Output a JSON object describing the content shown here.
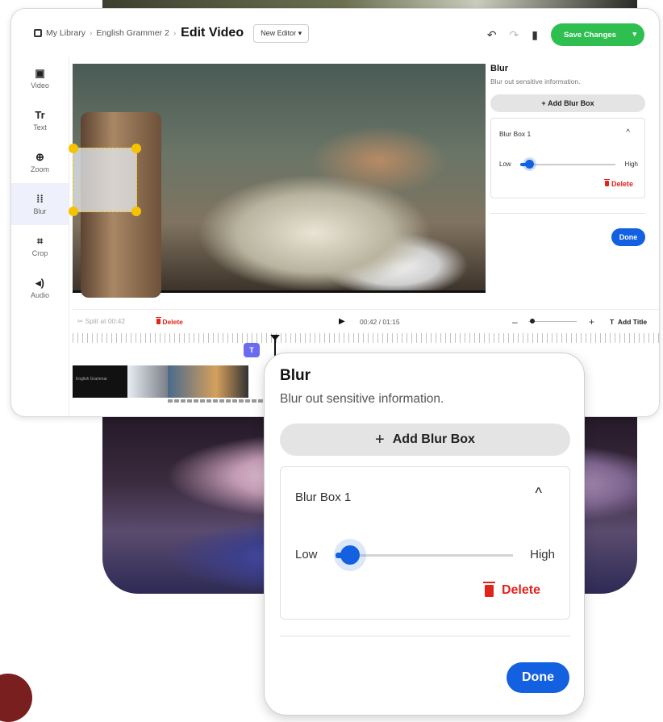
{
  "colors": {
    "accent": "#1360e0",
    "save": "#2fbf50",
    "danger": "#e2231a",
    "blur_handle": "#f5c300",
    "title_badge": "#6b6bf0"
  },
  "header": {
    "breadcrumb": [
      "My Library",
      "English Grammer 2"
    ],
    "title": "Edit Video",
    "editor_select": "New Editor",
    "save_label": "Save Changes"
  },
  "sidebar": {
    "items": [
      {
        "label": "Video",
        "icon": "video-icon"
      },
      {
        "label": "Text",
        "icon": "text-icon"
      },
      {
        "label": "Zoom",
        "icon": "zoom-icon"
      },
      {
        "label": "Blur",
        "icon": "blur-icon",
        "active": true
      },
      {
        "label": "Crop",
        "icon": "crop-icon"
      },
      {
        "label": "Audio",
        "icon": "audio-icon"
      }
    ]
  },
  "panel": {
    "title": "Blur",
    "subtitle": "Blur out sensitive information.",
    "add_label": "Add Blur Box",
    "box_name": "Blur Box 1",
    "low_label": "Low",
    "high_label": "High",
    "blur_level": 0.08,
    "delete_label": "Delete",
    "done_label": "Done"
  },
  "timeline": {
    "split_label": "Split at 00:42",
    "delete_label": "Delete",
    "time": "00:42 / 01:15",
    "add_title_label": "Add Title",
    "badge": "T",
    "thumb_text": "English Grammar"
  },
  "overlay": {
    "title": "Blur",
    "subtitle": "Blur out sensitive information.",
    "add_label": "Add Blur Box",
    "box_name": "Blur Box 1",
    "low_label": "Low",
    "high_label": "High",
    "delete_label": "Delete",
    "done_label": "Done"
  }
}
